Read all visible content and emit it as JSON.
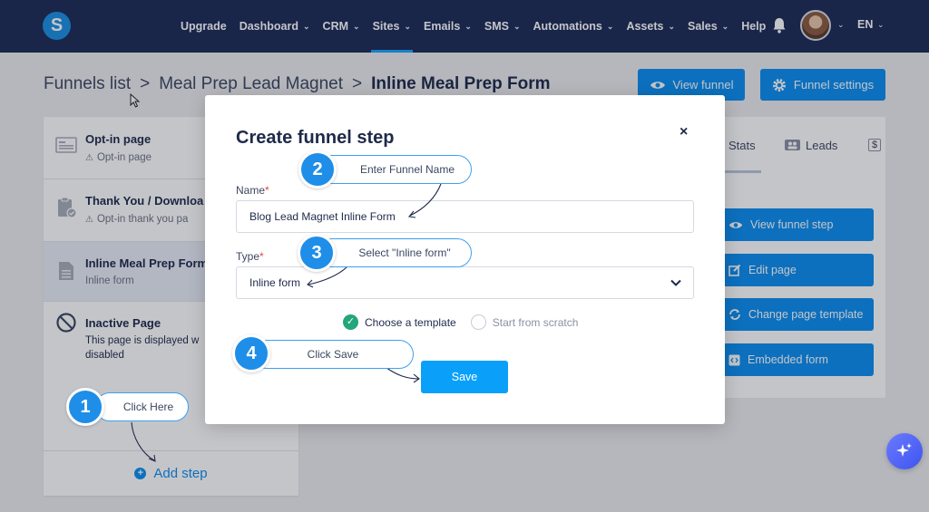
{
  "app": {
    "logo_letter": "S"
  },
  "nav": {
    "items": [
      {
        "label": "Upgrade",
        "has_menu": false,
        "active": false
      },
      {
        "label": "Dashboard",
        "has_menu": true,
        "active": false
      },
      {
        "label": "CRM",
        "has_menu": true,
        "active": false
      },
      {
        "label": "Sites",
        "has_menu": true,
        "active": true
      },
      {
        "label": "Emails",
        "has_menu": true,
        "active": false
      },
      {
        "label": "SMS",
        "has_menu": true,
        "active": false
      },
      {
        "label": "Automations",
        "has_menu": true,
        "active": false
      },
      {
        "label": "Assets",
        "has_menu": true,
        "active": false
      },
      {
        "label": "Sales",
        "has_menu": true,
        "active": false
      },
      {
        "label": "Help",
        "has_menu": false,
        "active": false
      }
    ],
    "language": "EN",
    "accent_color": "#1aa3ff",
    "bar_color": "#1b2a55"
  },
  "breadcrumb": {
    "items": [
      "Funnels list",
      "Meal Prep Lead Magnet",
      "Inline Meal Prep Form"
    ],
    "separator": ">"
  },
  "header_buttons": {
    "view_funnel": "View funnel",
    "funnel_settings": "Funnel settings"
  },
  "steps": [
    {
      "title": "Opt-in page",
      "subtitle": "Opt-in page",
      "icon": "page-layout-icon"
    },
    {
      "title": "Thank You / Downloa",
      "subtitle": "Opt-in thank you pa",
      "icon": "clipboard-check-icon"
    },
    {
      "title": "Inline Meal Prep Form",
      "subtitle": "Inline form",
      "icon": "document-icon"
    },
    {
      "title": "Inactive Page",
      "subtitle": "This page is displayed w disabled",
      "icon": "ban-icon"
    }
  ],
  "inactive_desc_line1": "This page is displayed w",
  "inactive_desc_line2": "disabled",
  "add_step_label": "Add step",
  "right_panel": {
    "tabs": [
      "Stats",
      "Leads",
      "$"
    ],
    "buttons": [
      "View funnel step",
      "Edit page",
      "Change page template",
      "Embedded form"
    ]
  },
  "modal": {
    "title": "Create funnel step",
    "close_symbol": "×",
    "name_label": "Name",
    "name_value": "Blog Lead Magnet Inline Form",
    "type_label": "Type",
    "type_value": "Inline form",
    "required_mark": "*",
    "option_template": "Choose a template",
    "option_scratch": "Start from scratch",
    "selected_option": "Choose a template",
    "save_label": "Save"
  },
  "callouts": [
    {
      "number": "1",
      "text": "Click Here"
    },
    {
      "number": "2",
      "text": "Enter Funnel Name"
    },
    {
      "number": "3",
      "text": "Select \"Inline form\""
    },
    {
      "number": "4",
      "text": "Click Save"
    }
  ],
  "colors": {
    "primary_button": "#0a8ef0",
    "save_button": "#0aa0fa",
    "callout": "#1e8ee8",
    "check_green": "#22a67a"
  }
}
